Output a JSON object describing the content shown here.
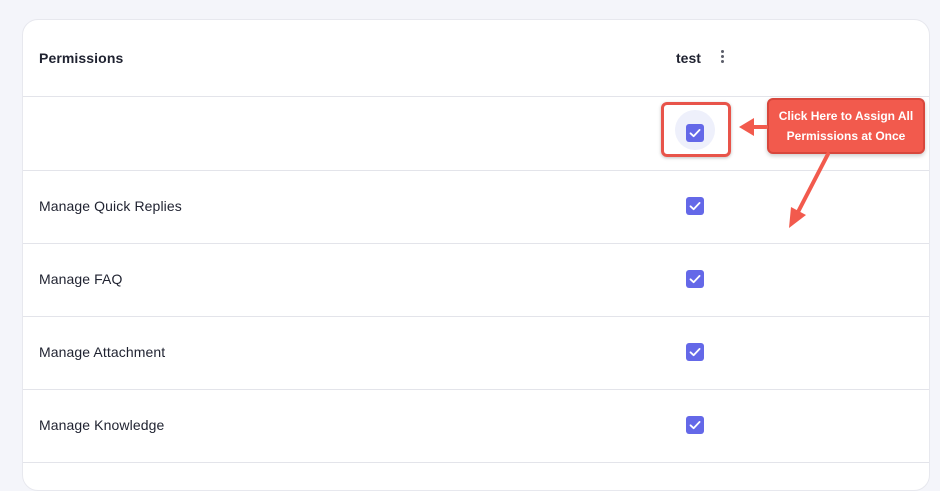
{
  "table": {
    "header": {
      "permissions_label": "Permissions",
      "column_title": "test"
    },
    "rows": [
      {
        "label": "",
        "checked": true
      },
      {
        "label": "Manage Quick Replies",
        "checked": true
      },
      {
        "label": "Manage FAQ",
        "checked": true
      },
      {
        "label": "Manage Attachment",
        "checked": true
      },
      {
        "label": "Manage Knowledge",
        "checked": true
      }
    ]
  },
  "annotation": {
    "line1": "Click Here to Assign All",
    "line2": "Permissions at Once"
  },
  "colors": {
    "checkbox": "#6468e8",
    "callout": "#f25a4d",
    "background": "#f4f5fa"
  },
  "icons": {
    "column_menu": "kebab-vertical-icon",
    "checkbox": "checkmark-icon"
  }
}
